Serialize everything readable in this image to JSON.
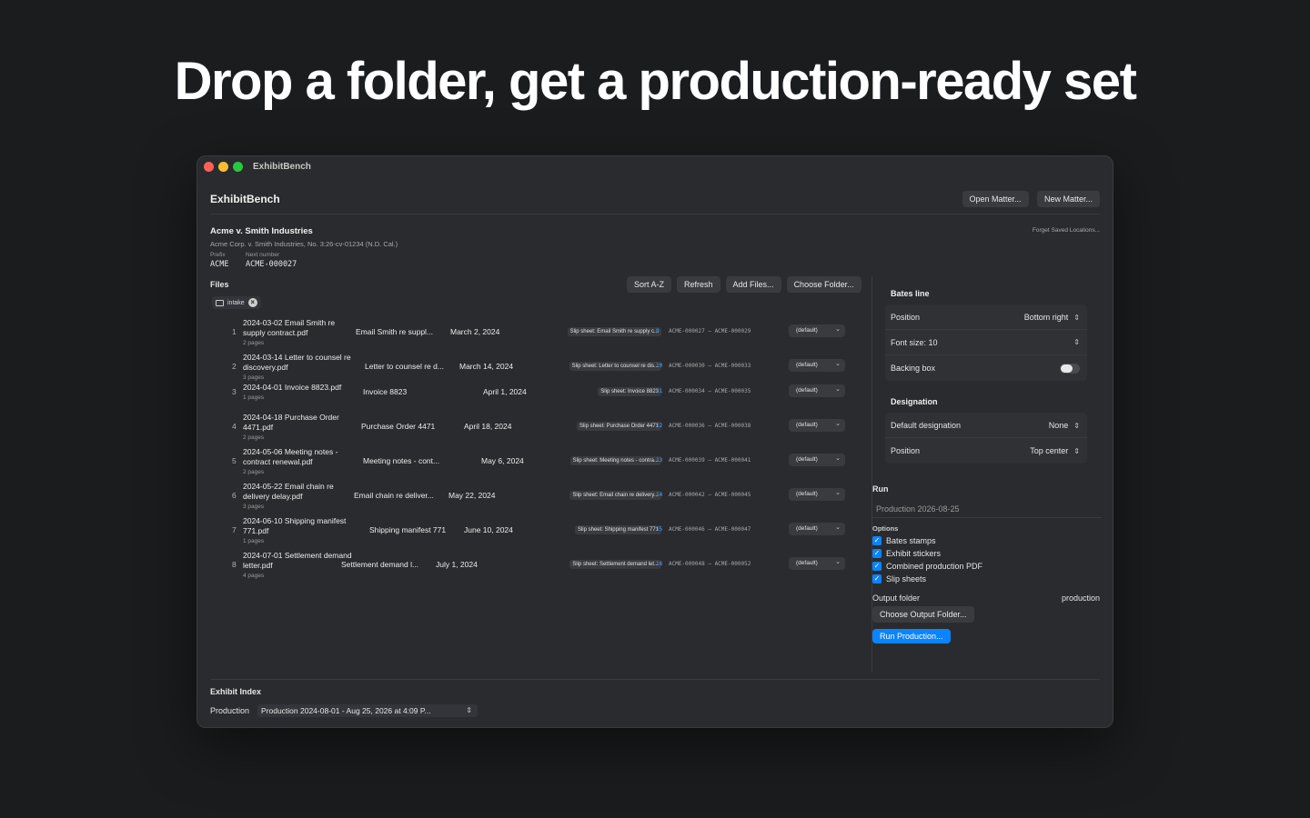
{
  "headline": "Drop a folder, get a production-ready set",
  "window": {
    "title": "ExhibitBench"
  },
  "header": {
    "app_name": "ExhibitBench",
    "open_label": "Open Matter...",
    "new_label": "New Matter..."
  },
  "matter": {
    "name": "Acme v. Smith Industries",
    "caption": "Acme Corp. v. Smith Industries, No. 3:26-cv-01234 (N.D. Cal.)",
    "prefix_label": "Prefix",
    "next_label": "Next number",
    "prefix": "ACME",
    "next_number": "ACME-000027",
    "forget_label": "Forget Saved Locations..."
  },
  "files": {
    "title": "Files",
    "buttons": {
      "sort": "Sort A-Z",
      "refresh": "Refresh",
      "add": "Add Files...",
      "choose": "Choose Folder..."
    },
    "chip": "intake",
    "rows": [
      {
        "idx": "1",
        "name": "2024-03-02 Email Smith re supply contract.pdf",
        "pages": "2 pages",
        "desc": "Email Smith re suppl...",
        "date": "March 2, 2024",
        "slip": "Slip sheet: Email Smith re supply c...",
        "exno": "9",
        "range": "ACME-000027 – ACME-000029",
        "designation": "(default)"
      },
      {
        "idx": "2",
        "name": "2024-03-14 Letter to counsel re discovery.pdf",
        "pages": "3 pages",
        "desc": "Letter to counsel re d...",
        "date": "March 14, 2024",
        "slip": "Slip sheet: Letter to counsel re dis...",
        "exno": "10",
        "range": "ACME-000030 – ACME-000033",
        "designation": "(default)"
      },
      {
        "idx": "3",
        "name": "2024-04-01 Invoice 8823.pdf",
        "pages": "1 pages",
        "desc": "Invoice 8823",
        "date": "April 1, 2024",
        "slip": "Slip sheet: Invoice 8823",
        "exno": "11",
        "range": "ACME-000034 – ACME-000035",
        "designation": "(default)"
      },
      {
        "idx": "4",
        "name": "2024-04-18 Purchase Order 4471.pdf",
        "pages": "2 pages",
        "desc": "Purchase Order 4471",
        "date": "April 18, 2024",
        "slip": "Slip sheet: Purchase Order 4471",
        "exno": "12",
        "range": "ACME-000036 – ACME-000038",
        "designation": "(default)"
      },
      {
        "idx": "5",
        "name": "2024-05-06 Meeting notes - contract renewal.pdf",
        "pages": "2 pages",
        "desc": "Meeting notes - cont...",
        "date": "May 6, 2024",
        "slip": "Slip sheet: Meeting notes - contra...",
        "exno": "13",
        "range": "ACME-000039 – ACME-000041",
        "designation": "(default)"
      },
      {
        "idx": "6",
        "name": "2024-05-22 Email chain re delivery delay.pdf",
        "pages": "3 pages",
        "desc": "Email chain re deliver...",
        "date": "May 22, 2024",
        "slip": "Slip sheet: Email chain re delivery...",
        "exno": "14",
        "range": "ACME-000042 – ACME-000045",
        "designation": "(default)"
      },
      {
        "idx": "7",
        "name": "2024-06-10 Shipping manifest 771.pdf",
        "pages": "1 pages",
        "desc": "Shipping manifest 771",
        "date": "June 10, 2024",
        "slip": "Slip sheet: Shipping manifest 771",
        "exno": "15",
        "range": "ACME-000046 – ACME-000047",
        "designation": "(default)"
      },
      {
        "idx": "8",
        "name": "2024-07-01 Settlement demand letter.pdf",
        "pages": "4 pages",
        "desc": "Settlement demand l...",
        "date": "July 1, 2024",
        "slip": "Slip sheet: Settlement demand let...",
        "exno": "16",
        "range": "ACME-000048 – ACME-000052",
        "designation": "(default)"
      }
    ]
  },
  "bates": {
    "title": "Bates line",
    "position_label": "Position",
    "position_value": "Bottom right",
    "font_label": "Font size: 10",
    "backing_label": "Backing box"
  },
  "designation": {
    "title": "Designation",
    "default_label": "Default designation",
    "default_value": "None",
    "position_label": "Position",
    "position_value": "Top center"
  },
  "run": {
    "title": "Run",
    "name_placeholder": "Production 2026-08-25",
    "options_title": "Options",
    "options": [
      "Bates stamps",
      "Exhibit stickers",
      "Combined production PDF",
      "Slip sheets"
    ],
    "output_label": "Output folder",
    "output_value": "production",
    "choose_output": "Choose Output Folder...",
    "run_button": "Run Production..."
  },
  "exhibit_index": {
    "title": "Exhibit Index",
    "production_label": "Production",
    "production_value": "Production 2024-08-01 - Aug 25, 2026 at 4:09 P..."
  },
  "colors": {
    "accent": "#0a84ff",
    "window_bg": "#2a2b2e",
    "page_bg": "#1b1c1e"
  }
}
